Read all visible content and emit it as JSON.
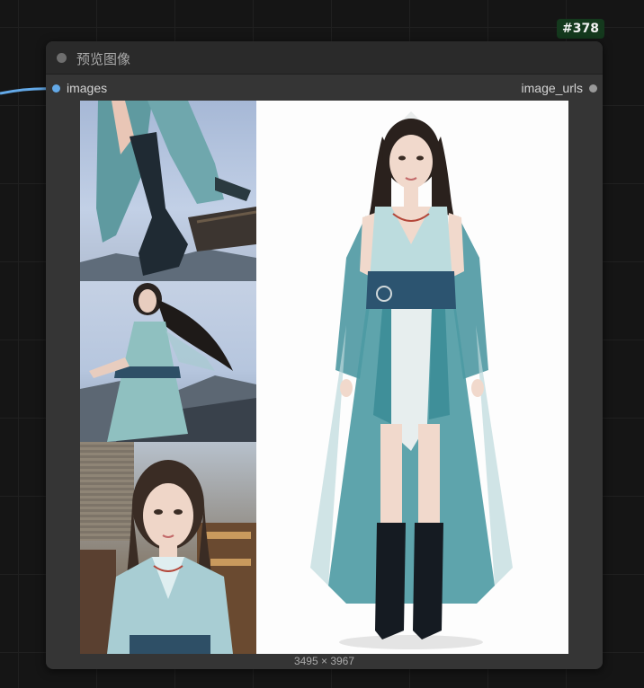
{
  "node": {
    "id_badge": "#378",
    "title": "预览图像",
    "input_label": "images",
    "output_label": "image_urls",
    "image_dims": "3495 × 3967"
  },
  "colors": {
    "canvas": "#151515",
    "node_body": "#353535",
    "node_header": "#2a2a2a",
    "badge_bg": "#14391d",
    "input_slot": "#63a9e8",
    "output_slot": "#9a9a9a"
  }
}
